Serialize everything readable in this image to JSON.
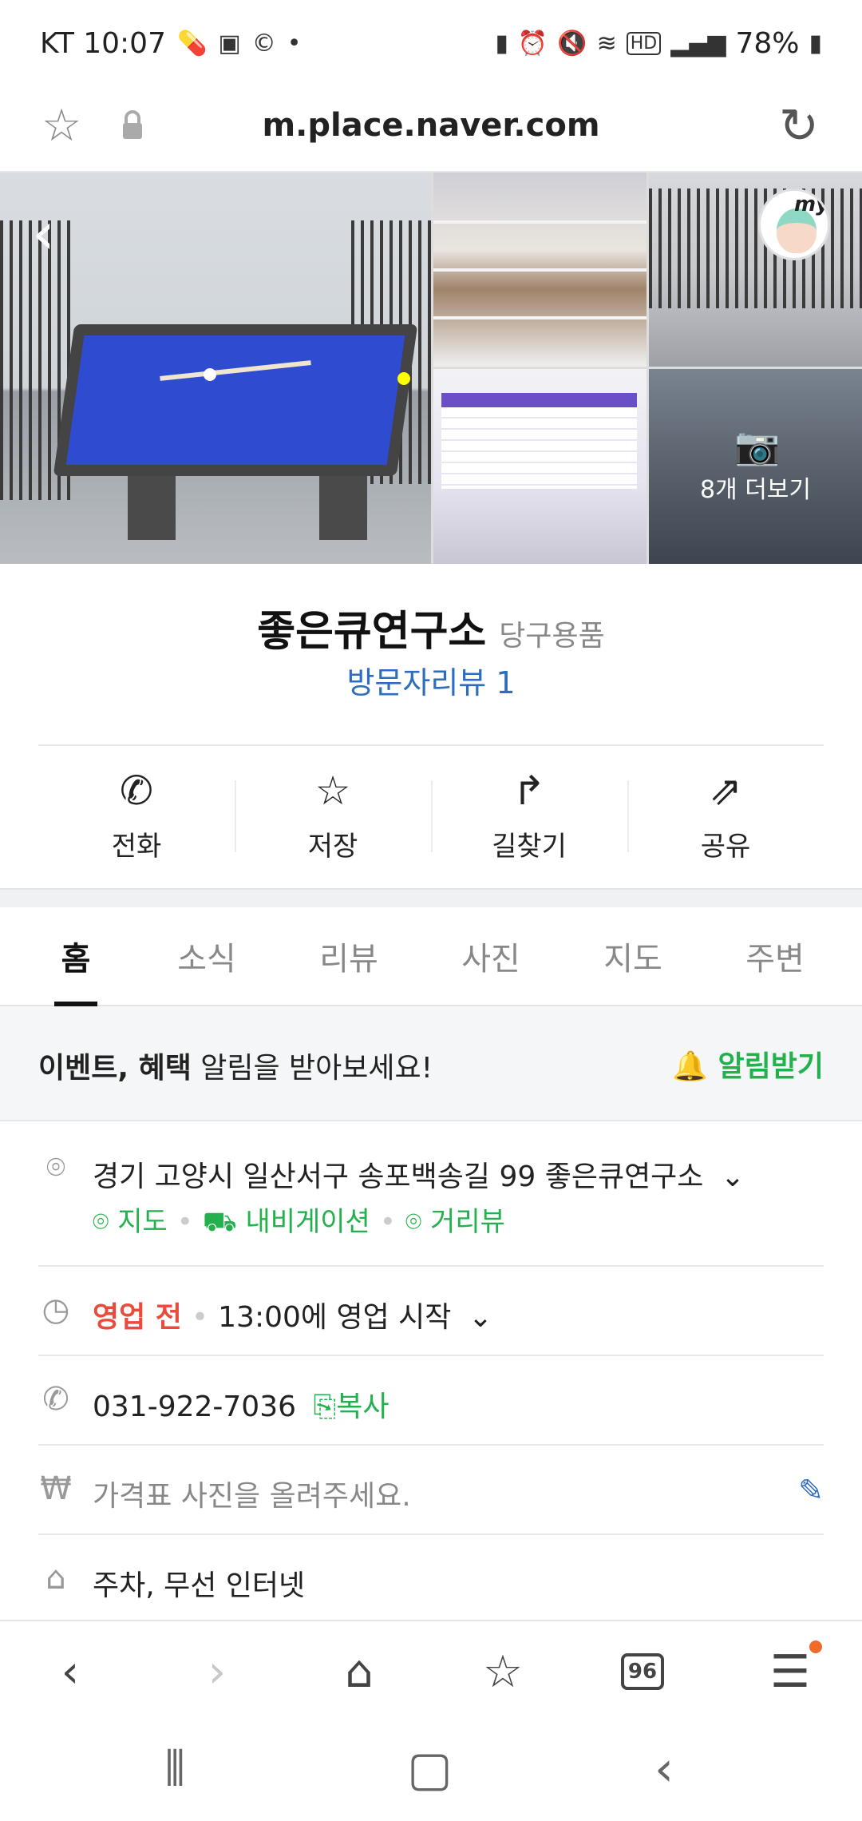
{
  "status_bar": {
    "time": "KT 10:07",
    "battery": "78%",
    "left_icons": [
      "pill-icon",
      "image-icon",
      "c-icon",
      "dot-icon"
    ],
    "right_icons": [
      "battery-saver-icon",
      "alarm-icon",
      "mute-icon",
      "wifi-icon",
      "hd-icon",
      "signal-icon",
      "battery-icon"
    ]
  },
  "url_bar": {
    "url": "m.place.naver.com"
  },
  "gallery": {
    "more_photos_label": "8개 더보기",
    "my_label": "my"
  },
  "place": {
    "name": "좋은큐연구소",
    "category": "당구용품",
    "visitor_review": "방문자리뷰 1"
  },
  "actions": [
    {
      "label": "전화",
      "icon": "phone-icon"
    },
    {
      "label": "저장",
      "icon": "star-icon"
    },
    {
      "label": "길찾기",
      "icon": "directions-icon"
    },
    {
      "label": "공유",
      "icon": "share-icon"
    }
  ],
  "tabs": [
    "홈",
    "소식",
    "리뷰",
    "사진",
    "지도",
    "주변"
  ],
  "active_tab": "홈",
  "notify": {
    "bold": "이벤트, 혜택",
    "text": " 알림을 받아보세요!",
    "button": "알림받기"
  },
  "info": {
    "address": "경기 고양시 일산서구 송포백송길 99 좋은큐연구소",
    "map_link": "지도",
    "navigation_link": "내비게이션",
    "streetview_link": "거리뷰",
    "hours_status": "영업 전",
    "hours_detail": "13:00에 영업 시작",
    "phone": "031-922-7036",
    "copy_label": "복사",
    "price_placeholder": "가격표 사진을 올려주세요.",
    "amenities": "주차, 무선 인터넷"
  },
  "browser_nav": {
    "tab_count": "96"
  },
  "colors": {
    "accent_green": "#22b14c",
    "link_blue": "#2e6cc0",
    "status_red": "#e84c3d"
  }
}
